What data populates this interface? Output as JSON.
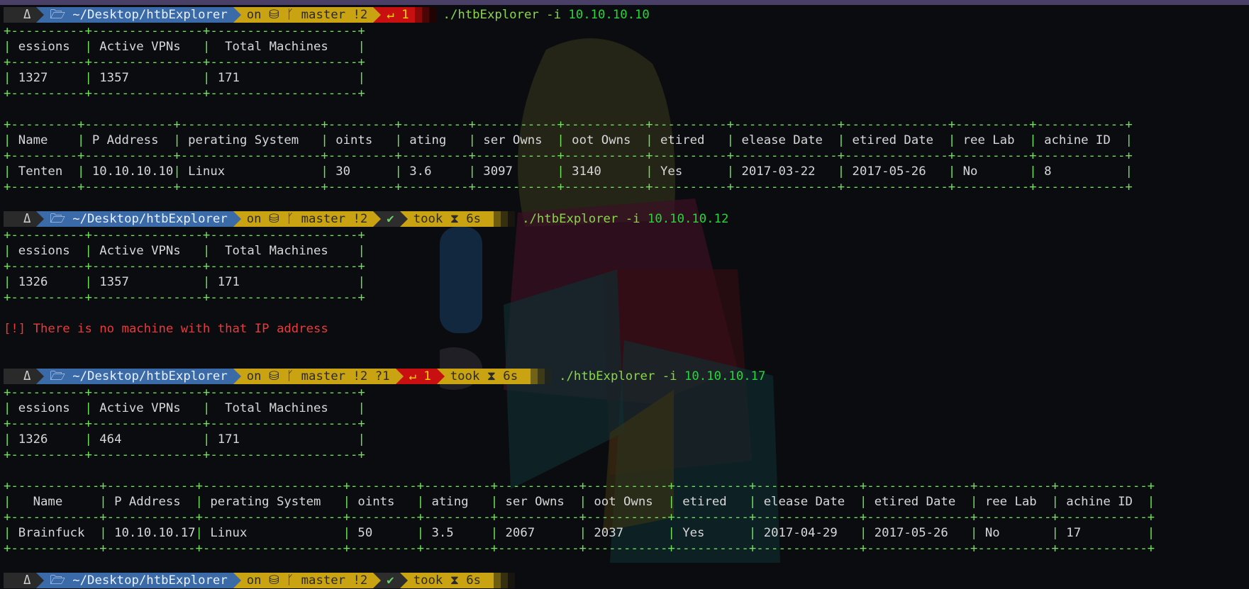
{
  "prompt": {
    "os_icon": "Δ",
    "dir": "~/Desktop/htbExplorer",
    "on": "on",
    "branch": "master"
  },
  "colors": {
    "dir_bg": "#3b6aa8",
    "git_bg": "#c9a312",
    "err_bg": "#c91010",
    "table_border": "#6fe25a",
    "error_text": "#e83a3a"
  },
  "blocks": [
    {
      "git_status": "!2",
      "exit": "1",
      "took": null,
      "command": "./htbExplorer -i",
      "ip": "10.10.10.10",
      "summary": {
        "headers": [
          "Sessions",
          "Active VPNs",
          "Total Machines"
        ],
        "row": [
          "1327",
          "1357",
          "171"
        ]
      },
      "machine": {
        "headers": [
          "Name",
          "IP Address",
          "Operating System",
          "Points",
          "Rating",
          "User Owns",
          "Root Owns",
          "Retired",
          "Release Date",
          "Retired Date",
          "Free Lab",
          "Machine ID"
        ],
        "row": [
          "Tenten",
          "10.10.10.10",
          "Linux",
          "30",
          "3.6",
          "3097",
          "3140",
          "Yes",
          "2017-03-22",
          "2017-05-26",
          "No",
          "8"
        ]
      }
    },
    {
      "git_status": "!2",
      "ok": "✔",
      "took": "took ⧗ 6s",
      "command": "./htbExplorer -i",
      "ip": "10.10.10.12",
      "summary": {
        "headers": [
          "Sessions",
          "Active VPNs",
          "Total Machines"
        ],
        "row": [
          "1326",
          "1357",
          "171"
        ]
      },
      "error": "[!] There is no machine with that IP address"
    },
    {
      "git_status": "!2 ?1",
      "exit": "1",
      "took": "took ⧗ 6s",
      "command": "./htbExplorer -i",
      "ip": "10.10.10.17",
      "summary": {
        "headers": [
          "Sessions",
          "Active VPNs",
          "Total Machines"
        ],
        "row": [
          "1326",
          "464",
          "171"
        ]
      },
      "machine": {
        "headers": [
          "Name",
          "IP Address",
          "Operating System",
          "Points",
          "Rating",
          "User Owns",
          "Root Owns",
          "Retired",
          "Release Date",
          "Retired Date",
          "Free Lab",
          "Machine ID"
        ],
        "row": [
          "Brainfuck",
          "10.10.10.17",
          "Linux",
          "50",
          "3.5",
          "2067",
          "2037",
          "Yes",
          "2017-04-29",
          "2017-05-26",
          "No",
          "17"
        ]
      }
    },
    {
      "git_status": "!2",
      "ok": "✔",
      "took": "took ⧗ 6s",
      "command": "",
      "ip": ""
    }
  ]
}
